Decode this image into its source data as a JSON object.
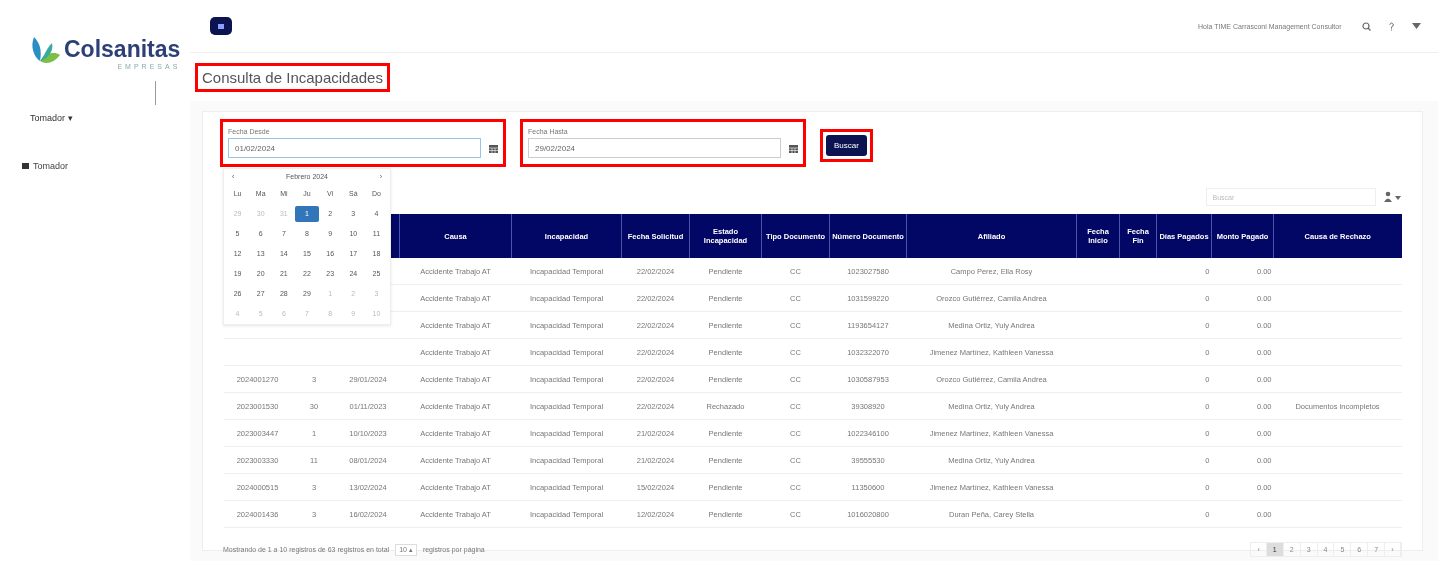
{
  "sidebar": {
    "logo": {
      "name": "Colsanitas",
      "subtitle": "EMPRESAS"
    },
    "user_dropdown": {
      "label": "Tomador ▾"
    },
    "items": [
      {
        "label": "Tomador",
        "selected": false
      }
    ]
  },
  "topbar": {
    "user": "Hola TIME Carrasconi Management Consultor"
  },
  "title": {
    "text": "Consulta de Incapacidades",
    "highlighted": true
  },
  "filters": {
    "date_from": {
      "label": "Fecha Desde",
      "value": "01/02/2024",
      "highlighted": true,
      "calendar": {
        "prev": "‹",
        "month": "Febrero 2024",
        "next": "›",
        "weekdays": [
          "Lu",
          "Ma",
          "Mi",
          "Ju",
          "Vi",
          "Sá",
          "Do"
        ],
        "days": [
          {
            "d": "29",
            "muted": true,
            "selected": false
          },
          {
            "d": "30",
            "muted": true,
            "selected": false
          },
          {
            "d": "31",
            "muted": true,
            "selected": false
          },
          {
            "d": "1",
            "muted": false,
            "selected": true
          },
          {
            "d": "2",
            "muted": false,
            "selected": false
          },
          {
            "d": "3",
            "muted": false,
            "selected": false
          },
          {
            "d": "4",
            "muted": false,
            "selected": false
          },
          {
            "d": "5",
            "muted": false,
            "selected": false
          },
          {
            "d": "6",
            "muted": false,
            "selected": false
          },
          {
            "d": "7",
            "muted": false,
            "selected": false
          },
          {
            "d": "8",
            "muted": false,
            "selected": false
          },
          {
            "d": "9",
            "muted": false,
            "selected": false
          },
          {
            "d": "10",
            "muted": false,
            "selected": false
          },
          {
            "d": "11",
            "muted": false,
            "selected": false
          },
          {
            "d": "12",
            "muted": false,
            "selected": false
          },
          {
            "d": "13",
            "muted": false,
            "selected": false
          },
          {
            "d": "14",
            "muted": false,
            "selected": false
          },
          {
            "d": "15",
            "muted": false,
            "selected": false
          },
          {
            "d": "16",
            "muted": false,
            "selected": false
          },
          {
            "d": "17",
            "muted": false,
            "selected": false
          },
          {
            "d": "18",
            "muted": false,
            "selected": false
          },
          {
            "d": "19",
            "muted": false,
            "selected": false
          },
          {
            "d": "20",
            "muted": false,
            "selected": false
          },
          {
            "d": "21",
            "muted": false,
            "selected": false
          },
          {
            "d": "22",
            "muted": false,
            "selected": false
          },
          {
            "d": "23",
            "muted": false,
            "selected": false
          },
          {
            "d": "24",
            "muted": false,
            "selected": false
          },
          {
            "d": "25",
            "muted": false,
            "selected": false
          },
          {
            "d": "26",
            "muted": false,
            "selected": false
          },
          {
            "d": "27",
            "muted": false,
            "selected": false
          },
          {
            "d": "28",
            "muted": false,
            "selected": false
          },
          {
            "d": "29",
            "muted": false,
            "selected": false
          },
          {
            "d": "1",
            "muted": true,
            "selected": false
          },
          {
            "d": "2",
            "muted": true,
            "selected": false
          },
          {
            "d": "3",
            "muted": true,
            "selected": false
          },
          {
            "d": "4",
            "muted": true,
            "selected": false
          },
          {
            "d": "5",
            "muted": true,
            "selected": false
          },
          {
            "d": "6",
            "muted": true,
            "selected": false
          },
          {
            "d": "7",
            "muted": true,
            "selected": false
          },
          {
            "d": "8",
            "muted": true,
            "selected": false
          },
          {
            "d": "9",
            "muted": true,
            "selected": false
          },
          {
            "d": "10",
            "muted": true,
            "selected": false
          }
        ]
      }
    },
    "date_to": {
      "label": "Fecha Hasta",
      "value": "29/02/2024",
      "highlighted": true
    },
    "search_button": {
      "label": "Buscar",
      "highlighted": true
    }
  },
  "table": {
    "search": {
      "placeholder": "Buscar"
    },
    "columns": [
      "Causa",
      "Incapacidad",
      "Fecha Solicitud",
      "Estado Incapacidad",
      "Tipo Documento",
      "Número Documento",
      "Afiliado",
      "Fecha Inicio",
      "Fecha Fin",
      "Días Pagados",
      "Monto Pagado",
      "Causa de Rechazo"
    ],
    "rows": [
      [
        "Accidente Trabajo AT",
        "Incapacidad Temporal",
        "22/02/2024",
        "Pendiente",
        "CC",
        "1023027580",
        "Campo Perez, Ella Rosy",
        null,
        null,
        "0",
        "0.00",
        null
      ],
      [
        "Accidente Trabajo AT",
        "Incapacidad Temporal",
        "22/02/2024",
        "Pendiente",
        "CC",
        "1031599220",
        "Orozco Gutiérrez, Camila Andrea",
        null,
        null,
        "0",
        "0.00",
        null
      ],
      [
        "Accidente Trabajo AT",
        "Incapacidad Temporal",
        "22/02/2024",
        "Pendiente",
        "CC",
        "1193654127",
        "Medina Ortiz, Yuly Andrea",
        null,
        null,
        "0",
        "0.00",
        null
      ],
      [
        "Accidente Trabajo AT",
        "Incapacidad Temporal",
        "22/02/2024",
        "Pendiente",
        "CC",
        "1032322070",
        "Jimenez Martínez, Kathleen Vanessa",
        null,
        null,
        "0",
        "0.00",
        null
      ],
      [
        "2024001270",
        "3",
        "29/01/2024",
        "Accidente Trabajo AT",
        "Incapacidad Temporal",
        "22/02/2024",
        "Pendiente",
        "CC",
        "1030587953",
        "Orozco Gutiérrez, Camila Andrea",
        null,
        null,
        "0",
        "0.00",
        null
      ],
      [
        "2023001530",
        "30",
        "01/11/2023",
        "Accidente Trabajo AT",
        "Incapacidad Temporal",
        "22/02/2024",
        "Rechazado",
        "CC",
        "39308920",
        "Medina Ortiz, Yuly Andrea",
        null,
        null,
        "0",
        "0.00",
        "Documentos incompletos"
      ],
      [
        "2023003447",
        "1",
        "10/10/2023",
        "Accidente Trabajo AT",
        "Incapacidad Temporal",
        "21/02/2024",
        "Pendiente",
        "CC",
        "1022346100",
        "Jimenez Martínez, Kathleen Vanessa",
        null,
        null,
        "0",
        "0.00",
        null
      ],
      [
        "2023003330",
        "11",
        "08/01/2024",
        "Accidente Trabajo AT",
        "Incapacidad Temporal",
        "21/02/2024",
        "Pendiente",
        "CC",
        "39555530",
        "Medina Ortiz, Yuly Andrea",
        null,
        null,
        "0",
        "0.00",
        null
      ],
      [
        "2024000515",
        "3",
        "13/02/2024",
        "Accidente Trabajo AT",
        "Incapacidad Temporal",
        "15/02/2024",
        "Pendiente",
        "CC",
        "11350600",
        "Jimenez Martínez, Kathleen Vanessa",
        null,
        null,
        "0",
        "0.00",
        null
      ],
      [
        "2024001436",
        "3",
        "16/02/2024",
        "Accidente Trabajo AT",
        "Incapacidad Temporal",
        "12/02/2024",
        "Pendiente",
        "CC",
        "1016020800",
        "Duran Peña, Carey Stella",
        null,
        null,
        "0",
        "0.00",
        null
      ]
    ],
    "footer": {
      "info": "Mostrando de 1 a 10 registros de 63 registros en total",
      "page_size": "10 ▴",
      "page_size_suffix": "registros por página"
    },
    "pagination": [
      {
        "label": "‹",
        "selected": false
      },
      {
        "label": "1",
        "selected": true
      },
      {
        "label": "2",
        "selected": false
      },
      {
        "label": "3",
        "selected": false
      },
      {
        "label": "4",
        "selected": false
      },
      {
        "label": "5",
        "selected": false
      },
      {
        "label": "6",
        "selected": false
      },
      {
        "label": "7",
        "selected": false
      },
      {
        "label": "›",
        "selected": false
      }
    ]
  }
}
